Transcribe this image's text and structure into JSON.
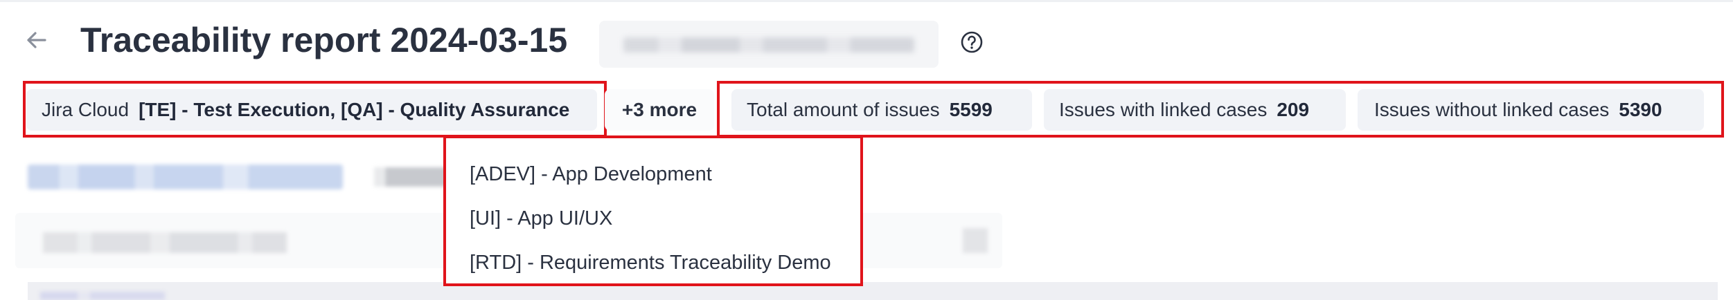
{
  "header": {
    "title": "Traceability report 2024-03-15"
  },
  "filters": {
    "source_label": "Jira Cloud",
    "projects_label": "[TE] - Test Execution, [QA] - Quality Assurance",
    "more_label": "+3 more",
    "more_items": [
      "[ADEV] - App Development",
      "[UI] - App UI/UX",
      "[RTD] - Requirements Traceability Demo"
    ]
  },
  "stats": {
    "total_label": "Total amount of issues",
    "total_value": "5599",
    "linked_label": "Issues with linked cases",
    "linked_value": "209",
    "unlinked_label": "Issues without linked cases",
    "unlinked_value": "5390"
  },
  "colors": {
    "highlight": "#e0141b",
    "chip_bg": "#f1f3f7",
    "text": "#2a3140"
  },
  "icons": {
    "back": "arrow-left-icon",
    "help": "question-circle-icon"
  }
}
